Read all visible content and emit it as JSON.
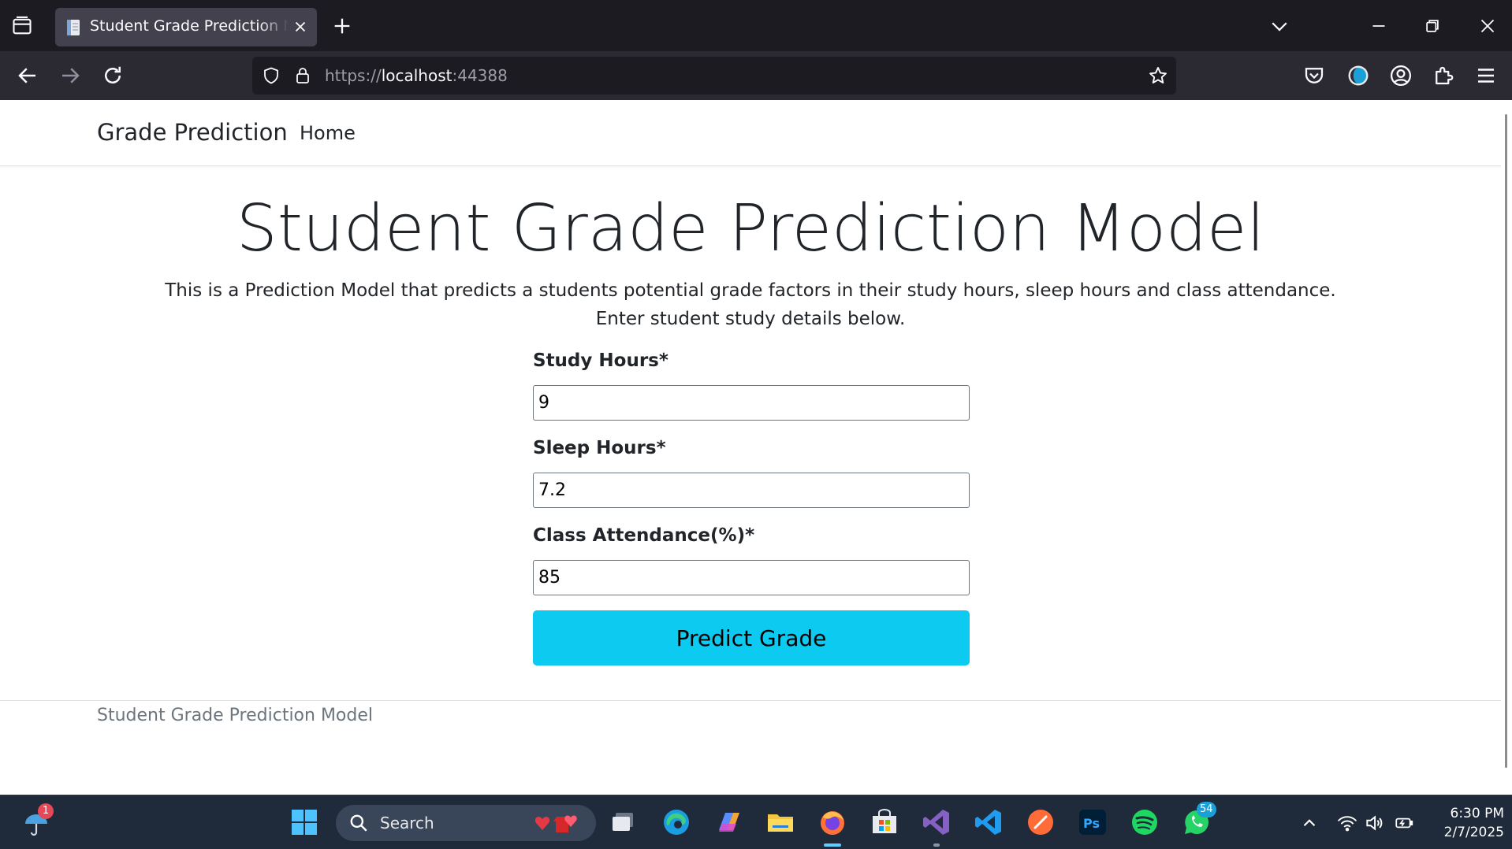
{
  "browser": {
    "tab_title": "Student Grade Prediction Model",
    "url_scheme": "https://",
    "url_host": "localhost",
    "url_port": ":44388"
  },
  "site": {
    "brand": "Grade Prediction",
    "nav_home": "Home"
  },
  "main": {
    "title": "Student Grade Prediction Model",
    "description": "This is a Prediction Model that predicts a students potential grade factors in their study hours, sleep hours and class attendance.",
    "instruction": "Enter student study details below."
  },
  "form": {
    "study_label": "Study Hours*",
    "study_value": "9",
    "sleep_label": "Sleep Hours*",
    "sleep_value": "7.2",
    "attendance_label": "Class Attendance(%)*",
    "attendance_value": "85",
    "submit_label": "Predict Grade"
  },
  "footer": {
    "text": "Student Grade Prediction Model"
  },
  "taskbar": {
    "search_placeholder": "Search",
    "weather_badge": "1",
    "whatsapp_badge": "54",
    "time": "6:30 PM",
    "date": "2/7/2025"
  },
  "colors": {
    "button_bg": "#0dcaf0",
    "chrome_dark": "#1c1b22",
    "chrome_toolbar": "#2b2a33",
    "taskbar_bg": "#1f2a3a"
  }
}
